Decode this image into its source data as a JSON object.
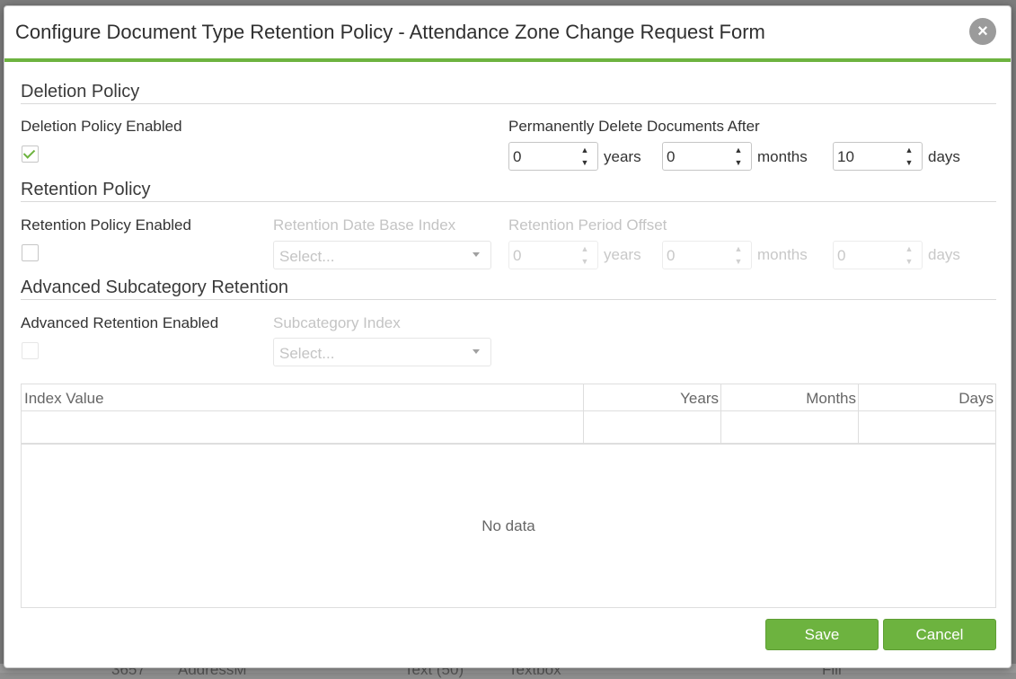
{
  "background_row": {
    "cells": [
      "3657",
      "AddressM",
      "Text (50)",
      "Textbox",
      "Fill"
    ]
  },
  "modal": {
    "title": "Configure Document Type Retention Policy - Attendance Zone Change Request Form",
    "close_icon": "close-icon",
    "accent_color": "#6db33f"
  },
  "deletion": {
    "title": "Deletion Policy",
    "enabled_label": "Deletion Policy Enabled",
    "enabled": true,
    "after_label": "Permanently Delete Documents After",
    "years": "0",
    "years_unit": "years",
    "months": "0",
    "months_unit": "months",
    "days": "10",
    "days_unit": "days"
  },
  "retention": {
    "title": "Retention Policy",
    "enabled_label": "Retention Policy Enabled",
    "enabled": false,
    "date_index_label": "Retention Date Base Index",
    "date_index_value": "Select...",
    "offset_label": "Retention Period Offset",
    "years": "0",
    "years_unit": "years",
    "months": "0",
    "months_unit": "months",
    "days": "0",
    "days_unit": "days"
  },
  "advanced": {
    "title": "Advanced Subcategory Retention",
    "enabled_label": "Advanced Retention Enabled",
    "enabled": false,
    "subcategory_label": "Subcategory Index",
    "subcategory_value": "Select..."
  },
  "grid": {
    "columns": [
      "Index Value",
      "Years",
      "Months",
      "Days"
    ],
    "empty_text": "No data"
  },
  "buttons": {
    "save": "Save",
    "cancel": "Cancel"
  }
}
